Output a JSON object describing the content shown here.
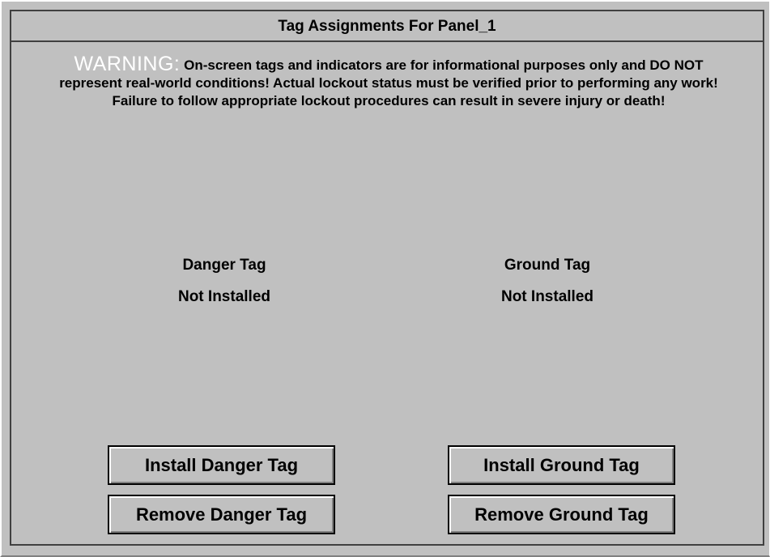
{
  "window": {
    "title": "Tag Assignments For Panel_1"
  },
  "warning": {
    "label": "WARNING:",
    "message": "On-screen tags and indicators are for informational purposes only and DO NOT represent real-world conditions!  Actual lockout status must be verified prior to performing any work!  Failure to follow appropriate lockout procedures can result in severe injury or death!"
  },
  "danger_tag": {
    "heading": "Danger Tag",
    "status": "Not Installed",
    "install_label": "Install Danger Tag",
    "remove_label": "Remove Danger Tag"
  },
  "ground_tag": {
    "heading": "Ground Tag",
    "status": "Not Installed",
    "install_label": "Install Ground Tag",
    "remove_label": "Remove Ground Tag"
  },
  "colors": {
    "background": "#c0c0c0",
    "warning_label": "#ffffff",
    "text": "#000000"
  }
}
